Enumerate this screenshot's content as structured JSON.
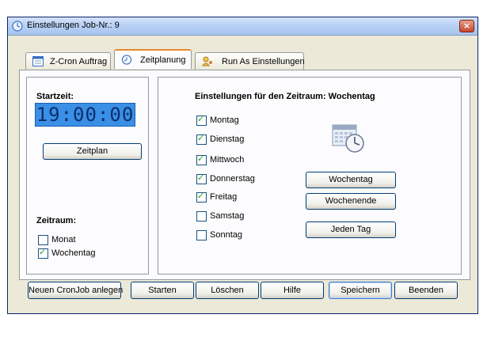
{
  "window": {
    "title": "Einstellungen Job-Nr.: 9",
    "close_label": "×"
  },
  "tabs": [
    {
      "label": "Z-Cron Auftrag",
      "icon": "window-icon",
      "active": false
    },
    {
      "label": "Zeitplanung",
      "icon": "clock-icon",
      "active": true
    },
    {
      "label": "Run As Einstellungen",
      "icon": "user-key-icon",
      "active": false
    }
  ],
  "left": {
    "startzeit_label": "Startzeit:",
    "time_display": "19:00:00",
    "zeitplan_button": "Zeitplan",
    "zeitraum_label": "Zeitraum:",
    "period_options": [
      {
        "label": "Monat",
        "checked": false
      },
      {
        "label": "Wochentag",
        "checked": true
      }
    ]
  },
  "right": {
    "heading": "Einstellungen für den Zeitraum: Wochentag",
    "days": [
      {
        "label": "Montag",
        "checked": true
      },
      {
        "label": "Dienstag",
        "checked": true
      },
      {
        "label": "Mittwoch",
        "checked": true
      },
      {
        "label": "Donnerstag",
        "checked": true
      },
      {
        "label": "Freitag",
        "checked": true
      },
      {
        "label": "Samstag",
        "checked": false
      },
      {
        "label": "Sonntag",
        "checked": false
      }
    ],
    "buttons": {
      "wochentag": "Wochentag",
      "wochenende": "Wochenende",
      "jeden_tag": "Jeden Tag"
    }
  },
  "footer": {
    "neuer_job": "Neuen CronJob anlegen",
    "starten": "Starten",
    "loeschen": "Löschen",
    "hilfe": "Hilfe",
    "speichern": "Speichern",
    "beenden": "Beenden"
  },
  "check_mark": "✓",
  "colors": {
    "accent": "#3b78d6",
    "display_bg": "#3a8fe6",
    "check": "#21a121"
  }
}
